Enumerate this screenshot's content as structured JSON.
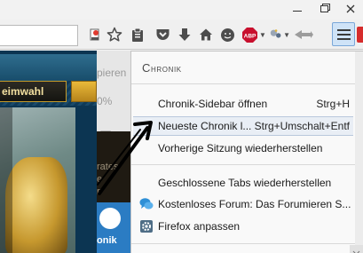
{
  "toolbar": {
    "icons": [
      "bookmark-star-icon",
      "reading-list-icon",
      "pocket-icon",
      "download-icon",
      "home-icon",
      "chat-icon",
      "adblock-plus-icon",
      "sync-icon",
      "hamburger-menu-icon"
    ],
    "adblock_label": "ABP"
  },
  "page_left": {
    "tab_label": "eimwahl"
  },
  "strip": {
    "text_1": "pieren",
    "text_2": "0%",
    "text_3": "rates",
    "text_4": "e",
    "text_5": "r",
    "footer_label": "onik"
  },
  "history_menu": {
    "heading": "Chronik",
    "items": [
      {
        "label": "Chronik-Sidebar öffnen",
        "shortcut": "Strg+H"
      },
      {
        "label": "Neueste Chronik l...",
        "shortcut": "Strg+Umschalt+Entf"
      },
      {
        "label": "Vorherige Sitzung wiederherstellen",
        "shortcut": ""
      },
      {
        "label": "Geschlossene Tabs wiederherstellen",
        "shortcut": ""
      },
      {
        "label": "Kostenloses Forum: Das Forumieren S...",
        "shortcut": ""
      },
      {
        "label": "Firefox anpassen",
        "shortcut": ""
      }
    ],
    "highlighted_index": 1
  },
  "colors": {
    "menu_button_bg": "#cfe3f7",
    "highlight_bg": "#e9eef5",
    "page_bg": "#0c3552",
    "adblock_red": "#c8102e"
  }
}
